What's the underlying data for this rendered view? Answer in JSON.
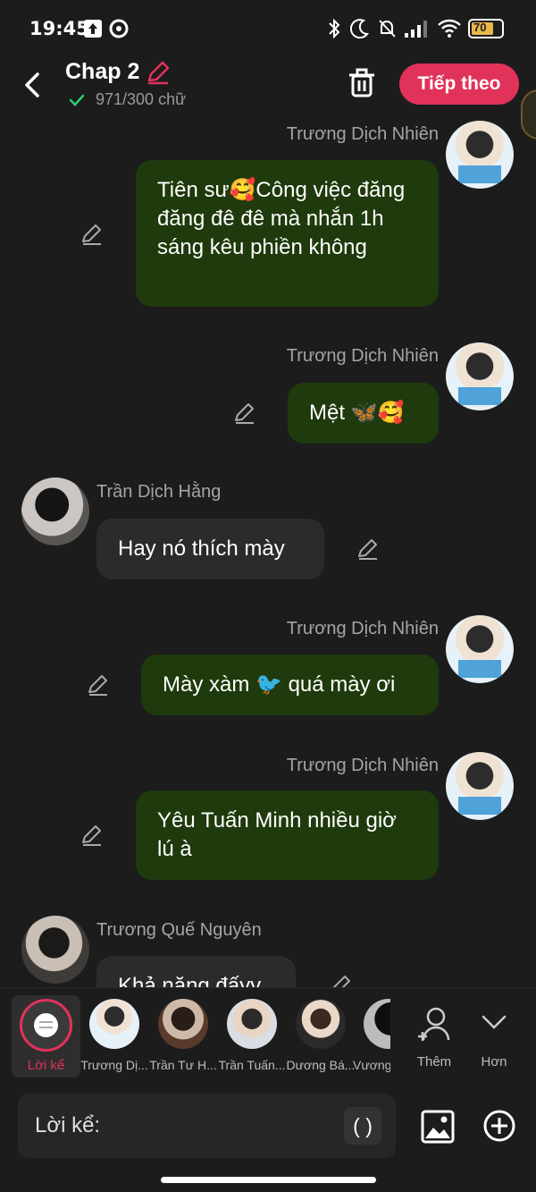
{
  "status": {
    "time": "19:45",
    "battery": "70"
  },
  "header": {
    "title": "Chap 2",
    "word_count": "971/300 chữ",
    "next_label": "Tiếp theo"
  },
  "messages": [
    {
      "sender": "Trương Dịch Nhiên",
      "text": "Tiên sư🥰Công việc đăng đăng đê đê mà nhắn 1h sáng kêu phiền không",
      "side": "right"
    },
    {
      "sender": "Trương Dịch Nhiên",
      "text": "Mệt 🦋🥰",
      "side": "right"
    },
    {
      "sender": "Trần Dịch Hằng",
      "text": "Hay nó thích mày",
      "side": "left"
    },
    {
      "sender": "Trương Dịch Nhiên",
      "text": "Mày xàm 🐦 quá mày ơi",
      "side": "right"
    },
    {
      "sender": "Trương Dịch Nhiên",
      "text": "Yêu Tuấn Minh nhiều giờ lú à",
      "side": "right"
    },
    {
      "sender": "Trương Quế Nguyên",
      "text": "Khả năng đấyy",
      "side": "left"
    }
  ],
  "characters": {
    "narrator_label": "Lời kể",
    "items": [
      "Trương Dị...",
      "Trần Tư H...",
      "Trần Tuấn...",
      "Dương Bá...",
      "Vương"
    ],
    "more_label": "Thêm",
    "expand_label": "Hơn"
  },
  "input": {
    "label": "Lời kể:",
    "paren": "( )"
  },
  "colors": {
    "accent": "#e1325a",
    "bubble_me": "#1f3a0c",
    "bubble_other": "#2b2b2b",
    "background": "#1c1c1c"
  }
}
